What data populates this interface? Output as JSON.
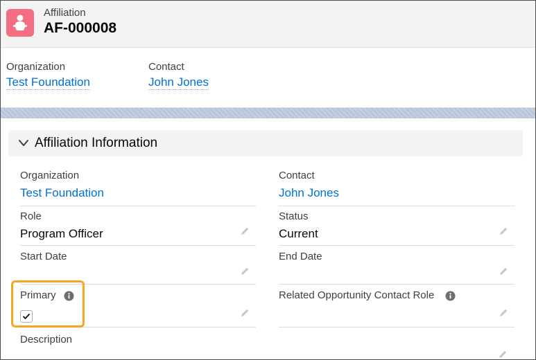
{
  "header": {
    "object_label": "Affiliation",
    "record_name": "AF-000008",
    "icon": "affiliation-icon",
    "icon_color": "#f36e83"
  },
  "highlights": [
    {
      "label": "Organization",
      "value": "Test Foundation"
    },
    {
      "label": "Contact",
      "value": "John Jones"
    }
  ],
  "section": {
    "title": "Affiliation Information",
    "expanded": true
  },
  "fields": {
    "organization": {
      "label": "Organization",
      "value": "Test Foundation"
    },
    "contact": {
      "label": "Contact",
      "value": "John Jones"
    },
    "role": {
      "label": "Role",
      "value": "Program Officer"
    },
    "status": {
      "label": "Status",
      "value": "Current"
    },
    "start_date": {
      "label": "Start Date",
      "value": ""
    },
    "end_date": {
      "label": "End Date",
      "value": ""
    },
    "primary": {
      "label": "Primary",
      "checked": true
    },
    "related_role": {
      "label": "Related Opportunity Contact Role",
      "value": ""
    },
    "description": {
      "label": "Description",
      "value": ""
    }
  },
  "colors": {
    "link": "#0070d2",
    "highlight_outline": "#f5a623"
  }
}
